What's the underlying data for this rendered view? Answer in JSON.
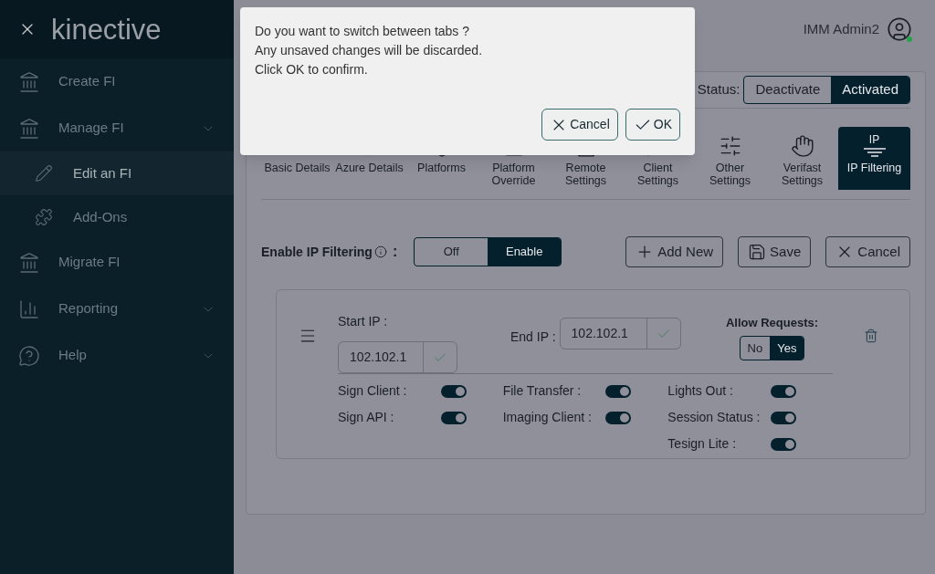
{
  "sidebar": {
    "logo": "kinective",
    "items": [
      {
        "label": "Create FI",
        "kind": "link",
        "selected": false
      },
      {
        "label": "Manage FI",
        "kind": "group",
        "selected": false,
        "children": [
          {
            "label": "Edit an FI",
            "selected": true
          },
          {
            "label": "Add-Ons",
            "selected": false
          }
        ]
      },
      {
        "label": "Migrate FI",
        "kind": "link",
        "selected": false
      },
      {
        "label": "Reporting",
        "kind": "group",
        "selected": false
      },
      {
        "label": "Help",
        "kind": "group",
        "selected": false
      }
    ]
  },
  "header": {
    "user": "IMM Admin2"
  },
  "status": {
    "label": "Status:",
    "options": [
      {
        "label": "Deactivate",
        "selected": false
      },
      {
        "label": "Activated",
        "selected": true
      }
    ]
  },
  "tabs": [
    {
      "label": "Basic Details",
      "selected": false
    },
    {
      "label": "Azure Details",
      "selected": false
    },
    {
      "label": "Platforms",
      "selected": false
    },
    {
      "label": "Platform Override",
      "selected": false
    },
    {
      "label": "Remote Settings",
      "selected": false
    },
    {
      "label": "Client Settings",
      "selected": false
    },
    {
      "label": "Other Settings",
      "selected": false
    },
    {
      "label": "Verifast Settings",
      "selected": false
    },
    {
      "label": "IP Filtering",
      "badge": "IP",
      "selected": true
    }
  ],
  "ip_filtering": {
    "label": "Enable IP Filtering",
    "colon": ":",
    "options": [
      {
        "label": "Off",
        "selected": false
      },
      {
        "label": "Enable",
        "selected": true
      }
    ]
  },
  "actions": [
    "Add New",
    "Save",
    "Cancel"
  ],
  "rule": {
    "start_label": "Start IP :",
    "start_value": "102.102.1",
    "end_label": "End IP :",
    "end_value": "102.102.1",
    "allow_label": "Allow Requests:",
    "allow_options": [
      {
        "label": "No",
        "selected": false
      },
      {
        "label": "Yes",
        "selected": true
      }
    ],
    "toggle_columns": [
      [
        {
          "label": "Sign Client :",
          "on": true
        },
        {
          "label": "Sign API :",
          "on": true
        }
      ],
      [
        {
          "label": "File Transfer :",
          "on": true
        },
        {
          "label": "Imaging Client :",
          "on": true
        }
      ],
      [
        {
          "label": "Lights Out :",
          "on": true
        },
        {
          "label": "Session Status :",
          "on": true
        },
        {
          "label": "Tesign Lite :",
          "on": true
        }
      ]
    ]
  },
  "dialog": {
    "lines": [
      "Do you want to switch between tabs ?",
      "Any unsaved changes will be discarded.",
      "Click OK to confirm."
    ],
    "buttons": [
      "Cancel",
      "OK"
    ]
  }
}
